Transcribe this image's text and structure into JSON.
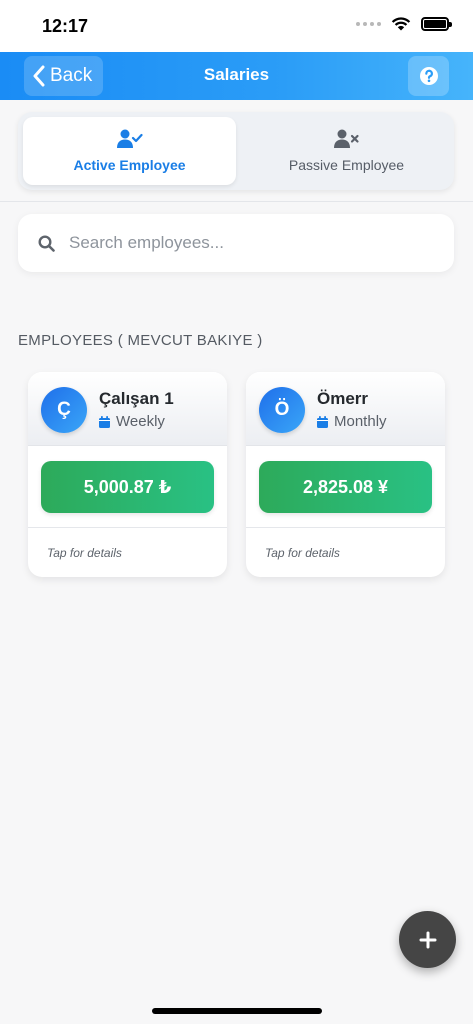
{
  "status_bar": {
    "time": "12:17"
  },
  "nav": {
    "back_label": "Back",
    "title": "Salaries"
  },
  "tabs": [
    {
      "label": "Active Employee",
      "icon": "user-check-icon",
      "active": true
    },
    {
      "label": "Passive Employee",
      "icon": "user-x-icon",
      "active": false
    }
  ],
  "search": {
    "placeholder": "Search employees...",
    "value": ""
  },
  "section": {
    "title": "EMPLOYEES ( MEVCUT BAKIYE )"
  },
  "employees": [
    {
      "initial": "Ç",
      "name": "Çalışan 1",
      "period": "Weekly",
      "balance": "5,000.87 ₺",
      "hint": "Tap for details"
    },
    {
      "initial": "Ö",
      "name": "Ömerr",
      "period": "Monthly",
      "balance": "2,825.08 ¥",
      "hint": "Tap for details"
    }
  ],
  "colors": {
    "nav_gradient_start": "#1a8cf5",
    "nav_gradient_end": "#46b4fb",
    "active_tab_text": "#1a7ee6",
    "balance_green": "#2daa5a",
    "fab": "#454545"
  }
}
